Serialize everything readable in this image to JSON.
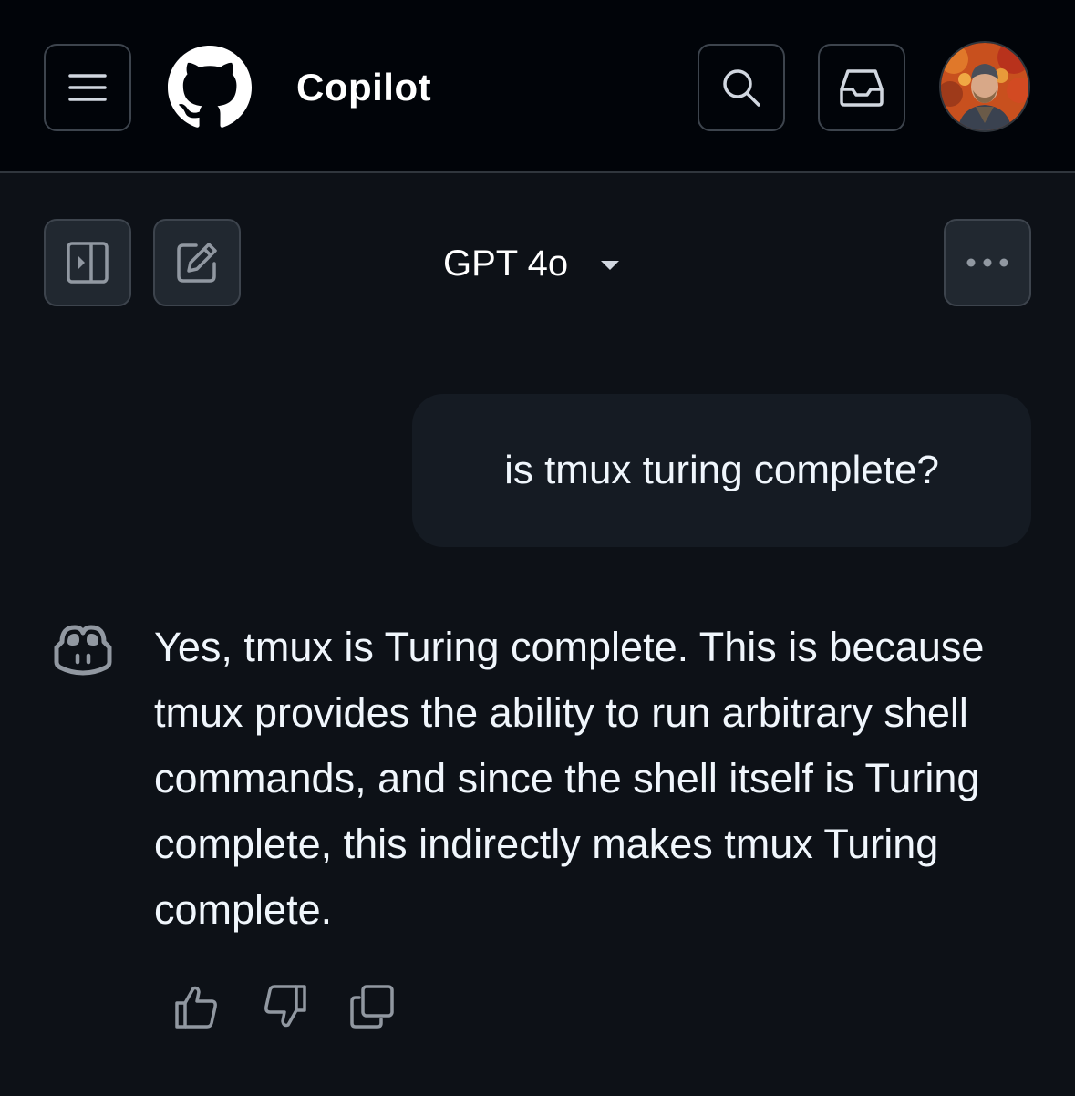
{
  "header": {
    "title": "Copilot",
    "icons": {
      "menu": "hamburger-icon",
      "logo": "github-logo",
      "search": "search-icon",
      "inbox": "inbox-icon",
      "avatar": "user-avatar"
    }
  },
  "toolbar": {
    "sidebar_icon": "sidebar-expand-icon",
    "new_chat_icon": "new-chat-icon",
    "model": "GPT 4o",
    "more_icon": "kebab-horizontal-icon"
  },
  "conversation": {
    "user_message": "is tmux turing complete?",
    "assistant_message": "Yes, tmux is Turing complete. This is because tmux provides the ability to run arbitrary shell commands, and since the shell itself is Turing complete, this indirectly makes tmux Turing complete.",
    "actions": [
      "thumbs-up-icon",
      "thumbs-down-icon",
      "copy-icon"
    ]
  },
  "colors": {
    "background": "#0d1117",
    "header_background": "#010409",
    "bubble": "#151b23",
    "border": "#3d444d",
    "text": "#f0f6fc",
    "icon_muted": "#9198a1"
  }
}
